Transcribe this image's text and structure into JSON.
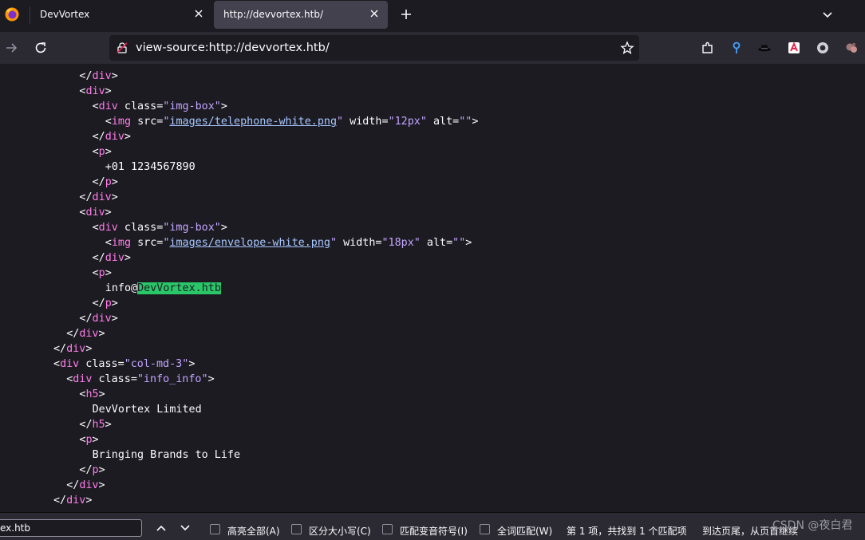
{
  "browser": {
    "tabs": [
      {
        "title": "DevVortex",
        "active": false
      },
      {
        "title": "http://devvortex.htb/",
        "active": true
      }
    ],
    "url": "view-source:http://devvortex.htb/"
  },
  "source_lines": [
    {
      "indent": 7,
      "parts": [
        [
          "br",
          "</"
        ],
        [
          "tg",
          "div"
        ],
        [
          "br",
          ">"
        ]
      ]
    },
    {
      "indent": 7,
      "parts": [
        [
          "br",
          "<"
        ],
        [
          "tg",
          "div"
        ],
        [
          "br",
          ">"
        ]
      ]
    },
    {
      "indent": 8,
      "parts": [
        [
          "br",
          "<"
        ],
        [
          "tg",
          "div"
        ],
        [
          "an",
          " class"
        ],
        [
          "br",
          "="
        ],
        [
          "av",
          "\"img-box\""
        ],
        [
          "br",
          ">"
        ]
      ]
    },
    {
      "indent": 9,
      "parts": [
        [
          "br",
          "<"
        ],
        [
          "tg",
          "img"
        ],
        [
          "an",
          " src"
        ],
        [
          "br",
          "="
        ],
        [
          "av",
          "\""
        ],
        [
          "lk",
          "images/telephone-white.png"
        ],
        [
          "av",
          "\""
        ],
        [
          "an",
          " width"
        ],
        [
          "br",
          "="
        ],
        [
          "av",
          "\"12px\""
        ],
        [
          "an",
          " alt"
        ],
        [
          "br",
          "="
        ],
        [
          "av",
          "\"\""
        ],
        [
          "br",
          ">"
        ]
      ]
    },
    {
      "indent": 8,
      "parts": [
        [
          "br",
          "</"
        ],
        [
          "tg",
          "div"
        ],
        [
          "br",
          ">"
        ]
      ]
    },
    {
      "indent": 8,
      "parts": [
        [
          "br",
          "<"
        ],
        [
          "tg",
          "p"
        ],
        [
          "br",
          ">"
        ]
      ]
    },
    {
      "indent": 9,
      "parts": [
        [
          "tx",
          "+01 1234567890"
        ]
      ]
    },
    {
      "indent": 8,
      "parts": [
        [
          "br",
          "</"
        ],
        [
          "tg",
          "p"
        ],
        [
          "br",
          ">"
        ]
      ]
    },
    {
      "indent": 7,
      "parts": [
        [
          "br",
          "</"
        ],
        [
          "tg",
          "div"
        ],
        [
          "br",
          ">"
        ]
      ]
    },
    {
      "indent": 7,
      "parts": [
        [
          "br",
          "<"
        ],
        [
          "tg",
          "div"
        ],
        [
          "br",
          ">"
        ]
      ]
    },
    {
      "indent": 8,
      "parts": [
        [
          "br",
          "<"
        ],
        [
          "tg",
          "div"
        ],
        [
          "an",
          " class"
        ],
        [
          "br",
          "="
        ],
        [
          "av",
          "\"img-box\""
        ],
        [
          "br",
          ">"
        ]
      ]
    },
    {
      "indent": 9,
      "parts": [
        [
          "br",
          "<"
        ],
        [
          "tg",
          "img"
        ],
        [
          "an",
          " src"
        ],
        [
          "br",
          "="
        ],
        [
          "av",
          "\""
        ],
        [
          "lk",
          "images/envelope-white.png"
        ],
        [
          "av",
          "\""
        ],
        [
          "an",
          " width"
        ],
        [
          "br",
          "="
        ],
        [
          "av",
          "\"18px\""
        ],
        [
          "an",
          " alt"
        ],
        [
          "br",
          "="
        ],
        [
          "av",
          "\"\""
        ],
        [
          "br",
          ">"
        ]
      ]
    },
    {
      "indent": 8,
      "parts": [
        [
          "br",
          "</"
        ],
        [
          "tg",
          "div"
        ],
        [
          "br",
          ">"
        ]
      ]
    },
    {
      "indent": 8,
      "parts": [
        [
          "br",
          "<"
        ],
        [
          "tg",
          "p"
        ],
        [
          "br",
          ">"
        ]
      ]
    },
    {
      "indent": 9,
      "parts": [
        [
          "tx",
          "info@"
        ],
        [
          "hl",
          "DevVortex.htb"
        ]
      ]
    },
    {
      "indent": 8,
      "parts": [
        [
          "br",
          "</"
        ],
        [
          "tg",
          "p"
        ],
        [
          "br",
          ">"
        ]
      ]
    },
    {
      "indent": 7,
      "parts": [
        [
          "br",
          "</"
        ],
        [
          "tg",
          "div"
        ],
        [
          "br",
          ">"
        ]
      ]
    },
    {
      "indent": 6,
      "parts": [
        [
          "br",
          "</"
        ],
        [
          "tg",
          "div"
        ],
        [
          "br",
          ">"
        ]
      ]
    },
    {
      "indent": 5,
      "parts": [
        [
          "br",
          "</"
        ],
        [
          "tg",
          "div"
        ],
        [
          "br",
          ">"
        ]
      ]
    },
    {
      "indent": 5,
      "parts": [
        [
          "br",
          "<"
        ],
        [
          "tg",
          "div"
        ],
        [
          "an",
          " class"
        ],
        [
          "br",
          "="
        ],
        [
          "av",
          "\"col-md-3\""
        ],
        [
          "br",
          ">"
        ]
      ]
    },
    {
      "indent": 6,
      "parts": [
        [
          "br",
          "<"
        ],
        [
          "tg",
          "div"
        ],
        [
          "an",
          " class"
        ],
        [
          "br",
          "="
        ],
        [
          "av",
          "\"info_info\""
        ],
        [
          "br",
          ">"
        ]
      ]
    },
    {
      "indent": 7,
      "parts": [
        [
          "br",
          "<"
        ],
        [
          "tg",
          "h5"
        ],
        [
          "br",
          ">"
        ]
      ]
    },
    {
      "indent": 8,
      "parts": [
        [
          "tx",
          "DevVortex Limited"
        ]
      ]
    },
    {
      "indent": 7,
      "parts": [
        [
          "br",
          "</"
        ],
        [
          "tg",
          "h5"
        ],
        [
          "br",
          ">"
        ]
      ]
    },
    {
      "indent": 7,
      "parts": [
        [
          "br",
          "<"
        ],
        [
          "tg",
          "p"
        ],
        [
          "br",
          ">"
        ]
      ]
    },
    {
      "indent": 8,
      "parts": [
        [
          "tx",
          "Bringing Brands to Life"
        ]
      ]
    },
    {
      "indent": 7,
      "parts": [
        [
          "br",
          "</"
        ],
        [
          "tg",
          "p"
        ],
        [
          "br",
          ">"
        ]
      ]
    },
    {
      "indent": 6,
      "parts": [
        [
          "br",
          "</"
        ],
        [
          "tg",
          "div"
        ],
        [
          "br",
          ">"
        ]
      ]
    },
    {
      "indent": 5,
      "parts": [
        [
          "br",
          "</"
        ],
        [
          "tg",
          "div"
        ],
        [
          "br",
          ">"
        ]
      ]
    }
  ],
  "findbar": {
    "query": "ortex.htb",
    "options": [
      {
        "label": "高亮全部(A)",
        "checked": false
      },
      {
        "label": "区分大小写(C)",
        "checked": false
      },
      {
        "label": "匹配变音符号(I)",
        "checked": false
      },
      {
        "label": "全词匹配(W)",
        "checked": false
      }
    ],
    "match_status": "第 1 项，共找到 1 个匹配项",
    "wrap_status": "到达页尾，从页首继续"
  },
  "watermark": "CSDN @夜白君",
  "colors": {
    "tag": "#ff7de9",
    "attr_value": "#c3a4ff",
    "link": "#a7c7ff",
    "highlight": "#2ac769"
  }
}
